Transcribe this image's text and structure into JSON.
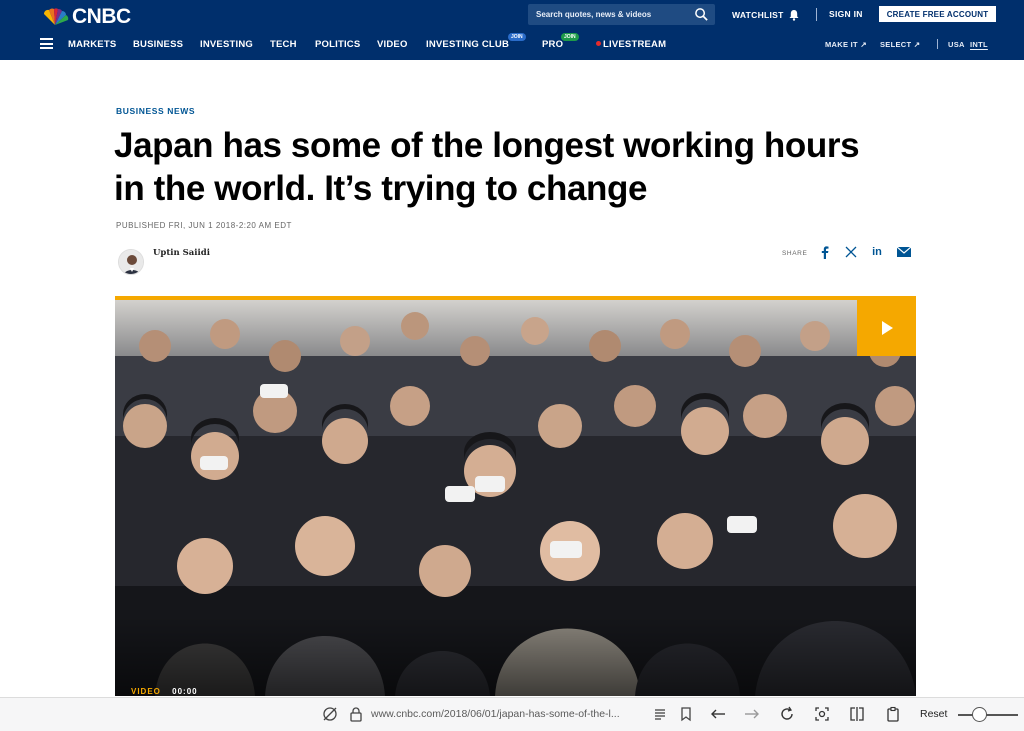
{
  "header": {
    "logo_text": "CNBC",
    "search_placeholder": "Search quotes, news & videos",
    "watchlist_label": "WATCHLIST",
    "signin_label": "SIGN IN",
    "cta_label": "CREATE FREE ACCOUNT"
  },
  "nav": {
    "items": [
      {
        "label": "MARKETS"
      },
      {
        "label": "BUSINESS"
      },
      {
        "label": "INVESTING"
      },
      {
        "label": "TECH"
      },
      {
        "label": "POLITICS"
      },
      {
        "label": "VIDEO"
      },
      {
        "label": "INVESTING CLUB",
        "badge": "JOIN"
      },
      {
        "label": "PRO",
        "badge": "JOIN"
      },
      {
        "label": "LIVESTREAM"
      }
    ],
    "make_it": "MAKE IT",
    "select": "SELECT",
    "usa": "USA",
    "intl": "INTL"
  },
  "article": {
    "kicker": "BUSINESS NEWS",
    "headline": "Japan has some of the longest working hours in the world. It’s trying to change",
    "published": "PUBLISHED FRI, JUN 1 2018-2:20 AM EDT",
    "author": "Uptin Saiidi",
    "share_label": "SHARE",
    "video_label": "VIDEO",
    "video_time": "00:00"
  },
  "browser": {
    "url": "www.cnbc.com/2018/06/01/japan-has-some-of-the-l...",
    "reset_label": "Reset"
  },
  "colors": {
    "header_bg": "#002f6c",
    "accent": "#f5a800",
    "link_blue": "#005594"
  }
}
